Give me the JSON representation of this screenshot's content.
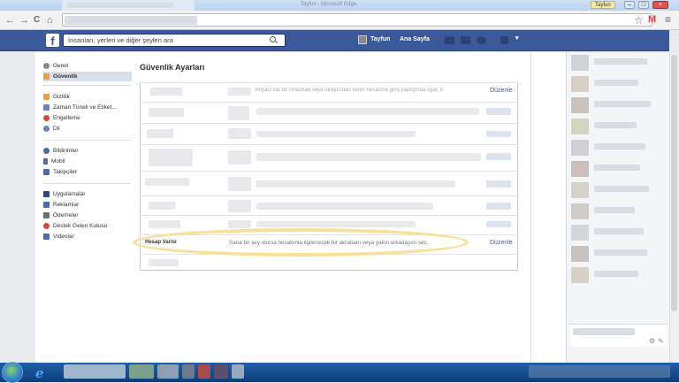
{
  "browser": {
    "window_title": "Tayfun - Microsoft Edge",
    "profile_chip": "Tayfun",
    "nav": {
      "back": "←",
      "forward": "→",
      "reload": "C",
      "home": "⌂"
    },
    "star": "☆",
    "menu": "≡",
    "gmail": "M"
  },
  "facebook": {
    "logo": "f",
    "search_placeholder": "İnsanları, yerleri ve diğer şeyleri ara",
    "user_name": "Tayfun",
    "home_link": "Ana Sayfa"
  },
  "sidebar": {
    "items": [
      {
        "label": "Genel",
        "icon": "gear-icon",
        "color": "#8a8a8a"
      },
      {
        "label": "Güvenlik",
        "icon": "shield-icon",
        "color": "#e9a23b",
        "active": true
      },
      {
        "label": "Gizlilik",
        "icon": "lock-icon",
        "color": "#e9a23b"
      },
      {
        "label": "Zaman Tüneli ve Etiket...",
        "icon": "timeline-icon",
        "color": "#6d84b4"
      },
      {
        "label": "Engelleme",
        "icon": "block-icon",
        "color": "#d9463b"
      },
      {
        "label": "Dil",
        "icon": "globe-icon",
        "color": "#6d84b4"
      },
      {
        "label": "Bildirimler",
        "icon": "globe-bell-icon",
        "color": "#4b6aa8"
      },
      {
        "label": "Mobil",
        "icon": "mobile-icon",
        "color": "#4b6aa8"
      },
      {
        "label": "Takipçiler",
        "icon": "rss-icon",
        "color": "#4b6aa8"
      },
      {
        "label": "Uygulamalar",
        "icon": "apps-icon",
        "color": "#2f477a"
      },
      {
        "label": "Reklamlar",
        "icon": "ads-icon",
        "color": "#4b6aa8"
      },
      {
        "label": "Ödemeler",
        "icon": "card-icon",
        "color": "#6d6d6d"
      },
      {
        "label": "Destek Gelen Kutusu",
        "icon": "lifebuoy-icon",
        "color": "#d9463b"
      },
      {
        "label": "Videolar",
        "icon": "film-icon",
        "color": "#4b6aa8"
      }
    ]
  },
  "main": {
    "title": "Güvenlik Ayarları",
    "first_row_fragment": "Ihtiyacı var bir cihazdan veya tarayıcıdan senin hesabına giriş yaptığında uyar. Il",
    "edit_label": "Düzenle",
    "legacy_contact": {
      "label": "Hesap Varisi",
      "description": "Sana bir şey olursa hesabınla ilgilenecek bir akrabanı veya yakın arkadaşını seç.",
      "edit_label": "Düzenle"
    }
  },
  "colors": {
    "fb_blue": "#3b5998",
    "highlight": "#f7dd8f"
  }
}
